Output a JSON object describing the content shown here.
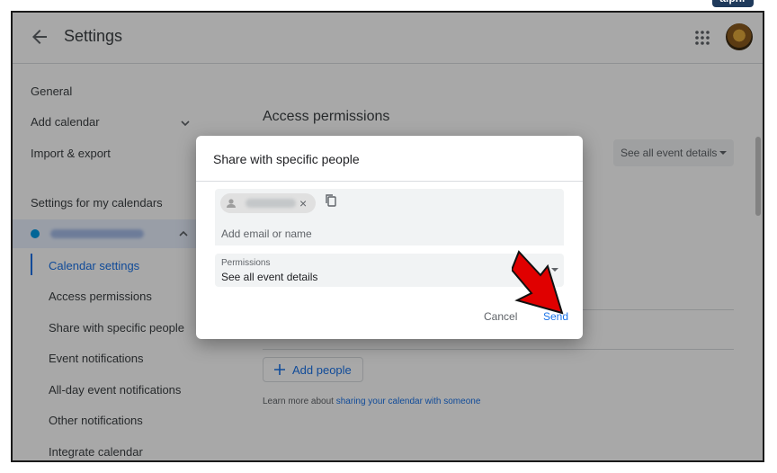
{
  "watermark": "alphr",
  "header": {
    "title": "Settings",
    "back_icon": "arrow-back-icon",
    "apps_icon": "apps-grid-icon"
  },
  "sidebar": {
    "items": [
      {
        "label": "General"
      },
      {
        "label": "Add calendar"
      },
      {
        "label": "Import & export"
      }
    ],
    "section_title": "Settings for my calendars",
    "calendar_color": "#039be5",
    "sub_items": [
      {
        "label": "Calendar settings",
        "active": true
      },
      {
        "label": "Access permissions"
      },
      {
        "label": "Share with specific people"
      },
      {
        "label": "Event notifications"
      },
      {
        "label": "All-day event notifications"
      },
      {
        "label": "Other notifications"
      },
      {
        "label": "Integrate calendar"
      }
    ]
  },
  "main": {
    "section_title": "Access permissions",
    "select_value": "See all event details",
    "add_people_label": "Add people",
    "learn_more_prefix": "Learn more about",
    "learn_more_link": "sharing your calendar with someone"
  },
  "dialog": {
    "title": "Share with specific people",
    "email_placeholder": "Add email or name",
    "permissions_label": "Permissions",
    "permissions_value": "See all event details",
    "chip_close": "×",
    "cancel_label": "Cancel",
    "send_label": "Send"
  },
  "colors": {
    "accent": "#1a73e8",
    "annotation_arrow": "#e00000",
    "overlay": "rgba(0,0,0,0.34)"
  }
}
